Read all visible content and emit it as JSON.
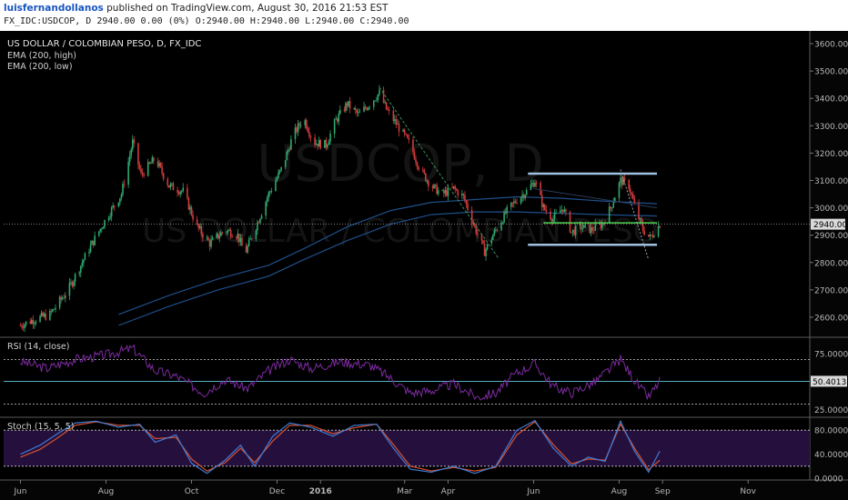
{
  "header": {
    "author": "luisfernandollanos",
    "published_text": "published on TradingView.com, August 30, 2016 21:53 EST",
    "quote_line": "FX_IDC:USDCOP, D  2940.00 0.00 (0%) O:2940.00 H:2940.00 L:2940.00 C:2940.00"
  },
  "chart_data": [
    {
      "type": "candlestick",
      "panel": "main",
      "title": "US DOLLAR / COLOMBIAN PESO, D, FX_IDC",
      "watermark_line1": "USDCOP, D",
      "watermark_line2": "US DOLLAR / COLOMBIAN PESO",
      "indicators": [
        "EMA (200, high)",
        "EMA (200, low)"
      ],
      "ylim": [
        2530,
        3640
      ],
      "y_ticks": [
        "3600.00",
        "3500.00",
        "3400.00",
        "3300.00",
        "3200.00",
        "3100.00",
        "3000.00",
        "2900.00",
        "2800.00",
        "2700.00",
        "2600.00"
      ],
      "y_tick_values": [
        3600,
        3500,
        3400,
        3300,
        3200,
        3100,
        3000,
        2900,
        2800,
        2700,
        2600
      ],
      "last_price_label": "2940.00",
      "last_price": 2940,
      "price_path": [
        [
          "2015-06-01",
          2570
        ],
        [
          "2015-06-10",
          2590
        ],
        [
          "2015-06-22",
          2610
        ],
        [
          "2015-07-05",
          2700
        ],
        [
          "2015-07-20",
          2850
        ],
        [
          "2015-08-01",
          2960
        ],
        [
          "2015-08-12",
          3050
        ],
        [
          "2015-08-20",
          3240
        ],
        [
          "2015-08-26",
          3120
        ],
        [
          "2015-09-05",
          3180
        ],
        [
          "2015-09-15",
          3080
        ],
        [
          "2015-09-25",
          3060
        ],
        [
          "2015-10-05",
          2930
        ],
        [
          "2015-10-14",
          2870
        ],
        [
          "2015-10-25",
          2920
        ],
        [
          "2015-11-03",
          2900
        ],
        [
          "2015-11-08",
          2830
        ],
        [
          "2015-11-15",
          2920
        ],
        [
          "2015-11-25",
          3050
        ],
        [
          "2015-12-05",
          3150
        ],
        [
          "2015-12-12",
          3260
        ],
        [
          "2015-12-20",
          3330
        ],
        [
          "2015-12-27",
          3240
        ],
        [
          "2016-01-05",
          3230
        ],
        [
          "2016-01-12",
          3320
        ],
        [
          "2016-01-20",
          3380
        ],
        [
          "2016-01-28",
          3340
        ],
        [
          "2016-02-05",
          3380
        ],
        [
          "2016-02-12",
          3420
        ],
        [
          "2016-02-17",
          3360
        ],
        [
          "2016-02-25",
          3300
        ],
        [
          "2016-03-05",
          3230
        ],
        [
          "2016-03-12",
          3140
        ],
        [
          "2016-03-20",
          3080
        ],
        [
          "2016-03-28",
          3050
        ],
        [
          "2016-04-05",
          3070
        ],
        [
          "2016-04-12",
          3040
        ],
        [
          "2016-04-20",
          2930
        ],
        [
          "2016-04-27",
          2840
        ],
        [
          "2016-05-03",
          2900
        ],
        [
          "2016-05-12",
          2980
        ],
        [
          "2016-05-20",
          3030
        ],
        [
          "2016-05-27",
          3060
        ],
        [
          "2016-06-02",
          3100
        ],
        [
          "2016-06-08",
          3000
        ],
        [
          "2016-06-15",
          2960
        ],
        [
          "2016-06-22",
          3000
        ],
        [
          "2016-06-28",
          2910
        ],
        [
          "2016-07-05",
          2930
        ],
        [
          "2016-07-12",
          2920
        ],
        [
          "2016-07-20",
          2940
        ],
        [
          "2016-07-26",
          3000
        ],
        [
          "2016-08-02",
          3100
        ],
        [
          "2016-08-08",
          3080
        ],
        [
          "2016-08-13",
          2990
        ],
        [
          "2016-08-18",
          2920
        ],
        [
          "2016-08-23",
          2890
        ],
        [
          "2016-08-30",
          2940
        ]
      ],
      "ema_high": [
        [
          "2015-08-10",
          2610
        ],
        [
          "2015-09-15",
          2680
        ],
        [
          "2015-10-20",
          2740
        ],
        [
          "2015-11-25",
          2790
        ],
        [
          "2015-12-20",
          2850
        ],
        [
          "2016-01-20",
          2930
        ],
        [
          "2016-02-20",
          2990
        ],
        [
          "2016-03-20",
          3020
        ],
        [
          "2016-04-20",
          3030
        ],
        [
          "2016-05-20",
          3040
        ],
        [
          "2016-06-20",
          3035
        ],
        [
          "2016-07-20",
          3025
        ],
        [
          "2016-08-28",
          3015
        ]
      ],
      "ema_low": [
        [
          "2015-08-10",
          2570
        ],
        [
          "2015-09-15",
          2640
        ],
        [
          "2015-10-20",
          2700
        ],
        [
          "2015-11-25",
          2750
        ],
        [
          "2015-12-20",
          2810
        ],
        [
          "2016-01-20",
          2880
        ],
        [
          "2016-02-20",
          2940
        ],
        [
          "2016-03-20",
          2975
        ],
        [
          "2016-04-20",
          2985
        ],
        [
          "2016-05-20",
          2985
        ],
        [
          "2016-06-20",
          2980
        ],
        [
          "2016-07-20",
          2975
        ],
        [
          "2016-08-28",
          2970
        ]
      ],
      "drawings": {
        "channel_top": [
          [
            "2016-05-28",
            3125
          ],
          [
            "2016-08-28",
            3125
          ]
        ],
        "channel_bottom": [
          [
            "2016-05-28",
            2865
          ],
          [
            "2016-08-28",
            2865
          ]
        ],
        "horizontal_green": [
          [
            "2016-06-08",
            2945
          ],
          [
            "2016-08-28",
            2945
          ]
        ],
        "trendline_mar": [
          [
            "2016-02-12",
            3440
          ],
          [
            "2016-05-07",
            2815
          ]
        ],
        "trendline_aug": [
          [
            "2016-08-02",
            3140
          ],
          [
            "2016-08-22",
            2810
          ]
        ],
        "trendline_faint": [
          [
            "2016-06-01",
            3070
          ],
          [
            "2016-08-28",
            3000
          ]
        ]
      }
    },
    {
      "type": "line",
      "panel": "rsi",
      "title": "RSI (14, close)",
      "ylim": [
        19,
        89
      ],
      "y_ticks": [
        "75.0000",
        "25.0000"
      ],
      "y_tick_values": [
        75,
        25
      ],
      "last_value_label": "50.4013",
      "last_value": 50.4013,
      "bands": [
        70,
        30
      ],
      "values": [
        [
          "2015-06-01",
          68
        ],
        [
          "2015-06-20",
          62
        ],
        [
          "2015-07-10",
          70
        ],
        [
          "2015-08-01",
          74
        ],
        [
          "2015-08-20",
          80
        ],
        [
          "2015-09-05",
          60
        ],
        [
          "2015-09-20",
          55
        ],
        [
          "2015-10-10",
          40
        ],
        [
          "2015-10-25",
          52
        ],
        [
          "2015-11-10",
          44
        ],
        [
          "2015-11-25",
          60
        ],
        [
          "2015-12-10",
          70
        ],
        [
          "2015-12-25",
          62
        ],
        [
          "2016-01-15",
          68
        ],
        [
          "2016-02-05",
          65
        ],
        [
          "2016-02-18",
          55
        ],
        [
          "2016-03-05",
          40
        ],
        [
          "2016-03-20",
          42
        ],
        [
          "2016-04-05",
          48
        ],
        [
          "2016-04-22",
          36
        ],
        [
          "2016-05-05",
          40
        ],
        [
          "2016-05-20",
          58
        ],
        [
          "2016-06-02",
          66
        ],
        [
          "2016-06-15",
          46
        ],
        [
          "2016-06-28",
          40
        ],
        [
          "2016-07-15",
          50
        ],
        [
          "2016-08-02",
          70
        ],
        [
          "2016-08-15",
          46
        ],
        [
          "2016-08-22",
          36
        ],
        [
          "2016-08-30",
          50.4
        ]
      ]
    },
    {
      "type": "line",
      "panel": "stoch",
      "title": "Stoch (15, 5, 5)",
      "ylim": [
        -3,
        100
      ],
      "y_ticks": [
        "80.0000",
        "40.0000",
        "0.0000"
      ],
      "y_tick_values": [
        80,
        40,
        0
      ],
      "bands": [
        80,
        20
      ],
      "series": [
        {
          "values": [
            [
              "2015-06-01",
              40
            ],
            [
              "2015-06-15",
              55
            ],
            [
              "2015-06-28",
              75
            ],
            [
              "2015-07-10",
              92
            ],
            [
              "2015-07-25",
              95
            ],
            [
              "2015-08-10",
              85
            ],
            [
              "2015-08-25",
              90
            ],
            [
              "2015-09-05",
              60
            ],
            [
              "2015-09-20",
              72
            ],
            [
              "2015-10-01",
              25
            ],
            [
              "2015-10-12",
              8
            ],
            [
              "2015-10-25",
              30
            ],
            [
              "2015-11-05",
              55
            ],
            [
              "2015-11-15",
              20
            ],
            [
              "2015-11-28",
              70
            ],
            [
              "2015-12-10",
              92
            ],
            [
              "2015-12-25",
              85
            ],
            [
              "2016-01-10",
              70
            ],
            [
              "2016-01-25",
              88
            ],
            [
              "2016-02-10",
              90
            ],
            [
              "2016-02-22",
              50
            ],
            [
              "2016-03-05",
              15
            ],
            [
              "2016-03-20",
              10
            ],
            [
              "2016-04-05",
              20
            ],
            [
              "2016-04-20",
              8
            ],
            [
              "2016-05-05",
              20
            ],
            [
              "2016-05-20",
              80
            ],
            [
              "2016-06-02",
              96
            ],
            [
              "2016-06-15",
              50
            ],
            [
              "2016-06-28",
              20
            ],
            [
              "2016-07-10",
              35
            ],
            [
              "2016-07-22",
              28
            ],
            [
              "2016-08-02",
              95
            ],
            [
              "2016-08-12",
              45
            ],
            [
              "2016-08-22",
              10
            ],
            [
              "2016-08-30",
              45
            ]
          ]
        },
        {
          "values": [
            [
              "2015-06-01",
              35
            ],
            [
              "2015-06-15",
              48
            ],
            [
              "2015-06-28",
              68
            ],
            [
              "2015-07-10",
              88
            ],
            [
              "2015-07-25",
              94
            ],
            [
              "2015-08-10",
              88
            ],
            [
              "2015-08-25",
              88
            ],
            [
              "2015-09-05",
              66
            ],
            [
              "2015-09-20",
              68
            ],
            [
              "2015-10-01",
              32
            ],
            [
              "2015-10-12",
              12
            ],
            [
              "2015-10-25",
              26
            ],
            [
              "2015-11-05",
              50
            ],
            [
              "2015-11-15",
              26
            ],
            [
              "2015-11-28",
              62
            ],
            [
              "2015-12-10",
              88
            ],
            [
              "2015-12-25",
              88
            ],
            [
              "2016-01-10",
              74
            ],
            [
              "2016-01-25",
              84
            ],
            [
              "2016-02-10",
              90
            ],
            [
              "2016-02-22",
              56
            ],
            [
              "2016-03-05",
              20
            ],
            [
              "2016-03-20",
              12
            ],
            [
              "2016-04-05",
              18
            ],
            [
              "2016-04-20",
              12
            ],
            [
              "2016-05-05",
              18
            ],
            [
              "2016-05-20",
              72
            ],
            [
              "2016-06-02",
              94
            ],
            [
              "2016-06-15",
              56
            ],
            [
              "2016-06-28",
              24
            ],
            [
              "2016-07-10",
              32
            ],
            [
              "2016-07-22",
              30
            ],
            [
              "2016-08-02",
              90
            ],
            [
              "2016-08-12",
              50
            ],
            [
              "2016-08-22",
              14
            ],
            [
              "2016-08-30",
              30
            ]
          ]
        }
      ]
    }
  ],
  "time_axis": {
    "ticks": [
      {
        "label": "Jun",
        "date": "2015-06-01"
      },
      {
        "label": "Aug",
        "date": "2015-08-01"
      },
      {
        "label": "Oct",
        "date": "2015-10-01"
      },
      {
        "label": "Dec",
        "date": "2015-12-01"
      },
      {
        "label": "2016",
        "date": "2016-01-01"
      },
      {
        "label": "Mar",
        "date": "2016-03-01"
      },
      {
        "label": "Apr",
        "date": "2016-04-01"
      },
      {
        "label": "Jun",
        "date": "2016-06-01"
      },
      {
        "label": "Aug",
        "date": "2016-08-01"
      },
      {
        "label": "Sep",
        "date": "2016-09-01"
      },
      {
        "label": "Nov",
        "date": "2016-11-01"
      }
    ],
    "range": [
      "2015-05-20",
      "2016-12-15"
    ]
  },
  "colors": {
    "background": "#000000",
    "up_candle": "#2fa86e",
    "down_candle": "#d03b3b",
    "ema": "#1f4f8a",
    "rsi_line": "#7b2a9e",
    "stoch_fill": "#25103d",
    "stoch_k": "#3d7bd6",
    "stoch_d": "#d8522f",
    "channel": "#9fc1e0",
    "horizontal": "#4ed14e",
    "trendline": "#3a8f5a",
    "axis_text": "#b8b8b8",
    "last_label_bg": "#d9d9d9"
  }
}
